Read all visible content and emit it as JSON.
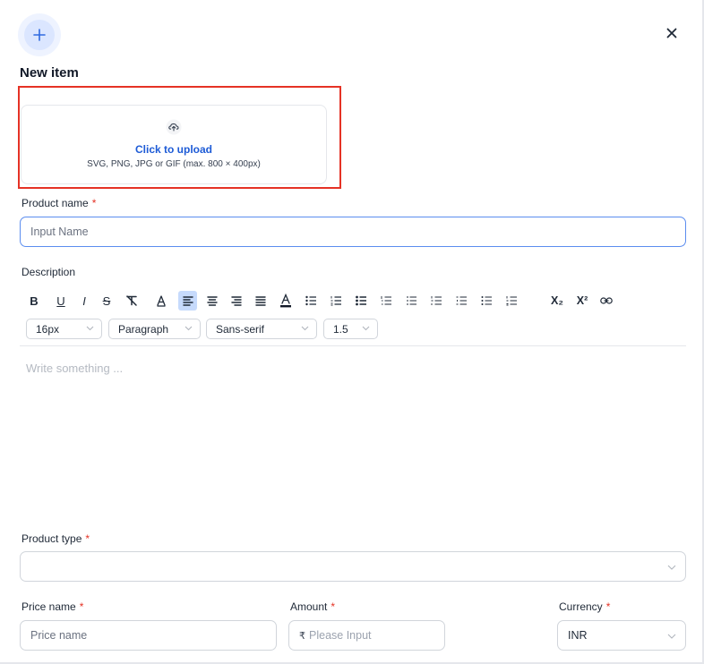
{
  "header": {
    "add_icon": "plus-icon",
    "close_icon": "close-icon",
    "title": "New item"
  },
  "upload": {
    "icon": "cloud-upload-icon",
    "link_label": "Click to upload",
    "hint": "SVG, PNG, JPG or GIF (max. 800 × 400px)",
    "highlight_color": "#e53225"
  },
  "product_name": {
    "label": "Product name",
    "required_mark": "*",
    "placeholder": "Input Name"
  },
  "description": {
    "label": "Description",
    "toolbar": {
      "bold": "B",
      "underline": "U",
      "italic": "I",
      "strike": "S",
      "subscript": "X₂",
      "superscript": "X²",
      "active_tool": "align-left",
      "active_color": "#c6dafc"
    },
    "selects": {
      "font_size": "16px",
      "block_type": "Paragraph",
      "font_family": "Sans-serif",
      "line_height": "1.5"
    },
    "placeholder": "Write something ..."
  },
  "product_type": {
    "label": "Product type",
    "required_mark": "*",
    "value": ""
  },
  "price": {
    "price_name_label": "Price name",
    "price_name_placeholder": "Price name",
    "amount_label": "Amount",
    "currency_symbol": "₹",
    "amount_placeholder": "Please Input",
    "currency_label": "Currency",
    "currency_value": "INR",
    "required_mark": "*"
  },
  "colors": {
    "accent": "#1d5bd6",
    "required": "#e53225",
    "focus_border": "#5b8def"
  }
}
